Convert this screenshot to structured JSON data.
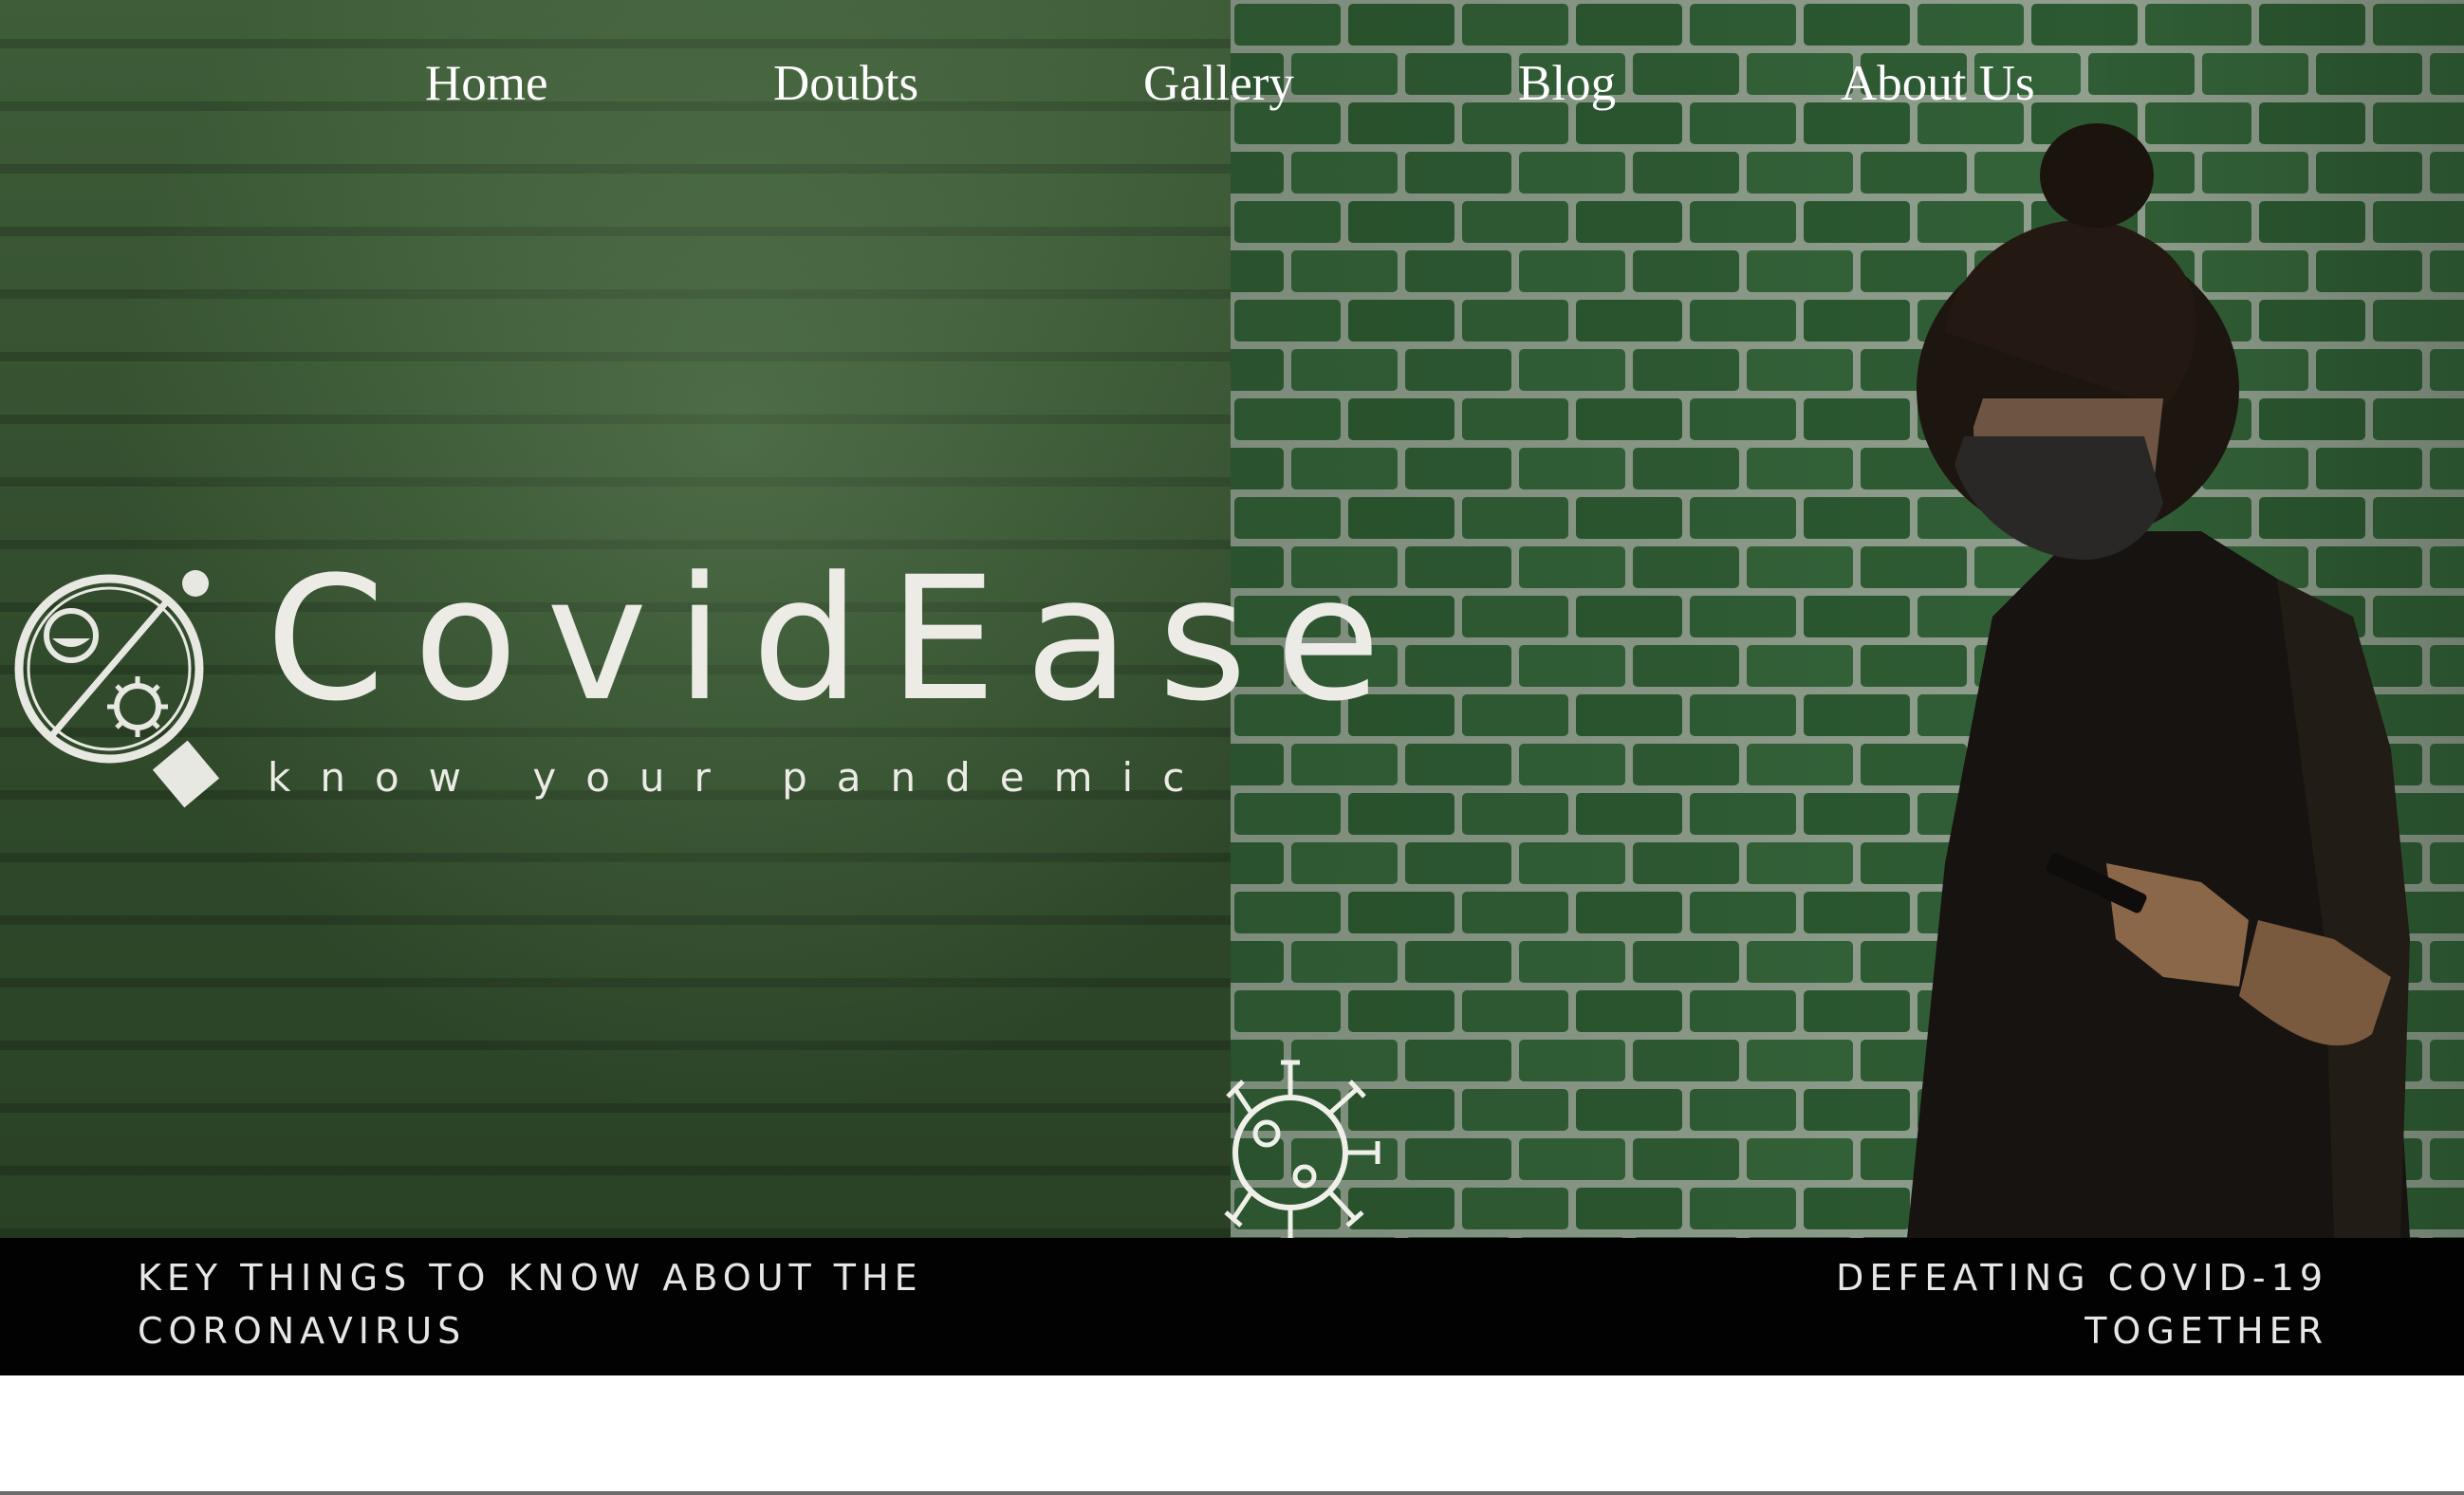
{
  "nav": {
    "items": [
      {
        "label": "Home"
      },
      {
        "label": "Doubts"
      },
      {
        "label": "Gallery"
      },
      {
        "label": "Blog"
      },
      {
        "label": "About Us"
      }
    ]
  },
  "brand": {
    "title": "CovidEase",
    "tagline": "know your pandemic"
  },
  "footer": {
    "left_text": "KEY THINGS TO KNOW ABOUT THE CORONAVIRUS",
    "right_line1": "DEFEATING COVID-19",
    "right_line2": "TOGETHER"
  },
  "icons": {
    "logo": "magnifier-virus-icon",
    "virus": "coronavirus-icon"
  },
  "colors": {
    "wall_green": "#2e5a33",
    "text_light": "#ecebe6",
    "footer_bg": "#020202"
  }
}
